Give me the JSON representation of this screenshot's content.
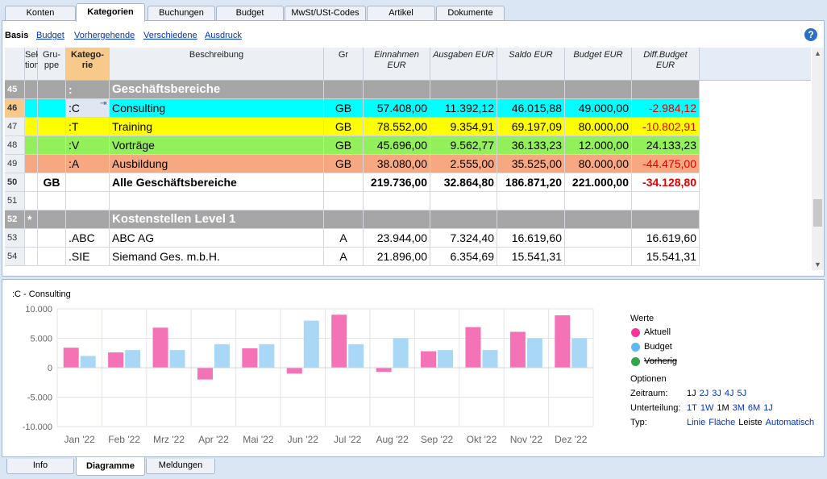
{
  "tabs": [
    "Konten",
    "Kategorien",
    "Buchungen",
    "Budget",
    "MwSt/USt-Codes",
    "Artikel",
    "Dokumente"
  ],
  "active_tab": "Kategorien",
  "views": {
    "active": "Basis",
    "links": [
      "Budget",
      "Vorhergehende",
      "Verschiedene",
      "Ausdruck"
    ]
  },
  "help_label": "?",
  "headers": {
    "sektion": "Sek tion",
    "gruppe": "Gru-ppe",
    "kategorie": "Katego-rie",
    "beschreibung": "Beschreibung",
    "gr": "Gr",
    "einnahmen": "Einnahmen EUR",
    "ausgaben": "Ausgaben EUR",
    "saldo": "Saldo EUR",
    "budget": "Budget EUR",
    "diff": "Diff.Budget EUR"
  },
  "rows": [
    {
      "nr": "45",
      "sektion": "",
      "gruppe": "",
      "kategorie": ":",
      "beschreibung": "Geschäftsbereiche",
      "gr": "",
      "einnahmen": "",
      "ausgaben": "",
      "saldo": "",
      "budget": "",
      "diff": "",
      "style": "gray"
    },
    {
      "nr": "46",
      "sektion": "",
      "gruppe": "",
      "kategorie": ":C",
      "beschreibung": "Consulting",
      "gr": "GB",
      "einnahmen": "57.408,00",
      "ausgaben": "11.392,12",
      "saldo": "46.015,88",
      "budget": "49.000,00",
      "diff": "-2.984,12",
      "style": "cyan"
    },
    {
      "nr": "47",
      "sektion": "",
      "gruppe": "",
      "kategorie": ":T",
      "beschreibung": "Training",
      "gr": "GB",
      "einnahmen": "78.552,00",
      "ausgaben": "9.354,91",
      "saldo": "69.197,09",
      "budget": "80.000,00",
      "diff": "-10.802,91",
      "style": "yellow"
    },
    {
      "nr": "48",
      "sektion": "",
      "gruppe": "",
      "kategorie": ":V",
      "beschreibung": "Vorträge",
      "gr": "GB",
      "einnahmen": "45.696,00",
      "ausgaben": "9.562,77",
      "saldo": "36.133,23",
      "budget": "12.000,00",
      "diff": "24.133,23",
      "style": "green"
    },
    {
      "nr": "49",
      "sektion": "",
      "gruppe": "",
      "kategorie": ":A",
      "beschreibung": "Ausbildung",
      "gr": "GB",
      "einnahmen": "38.080,00",
      "ausgaben": "2.555,00",
      "saldo": "35.525,00",
      "budget": "80.000,00",
      "diff": "-44.475,00",
      "style": "orange"
    },
    {
      "nr": "50",
      "sektion": "",
      "gruppe": "GB",
      "kategorie": "",
      "beschreibung": "Alle Geschäftsbereiche",
      "gr": "",
      "einnahmen": "219.736,00",
      "ausgaben": "32.864,80",
      "saldo": "186.871,20",
      "budget": "221.000,00",
      "diff": "-34.128,80",
      "style": "total"
    },
    {
      "nr": "51",
      "sektion": "",
      "gruppe": "",
      "kategorie": "",
      "beschreibung": "",
      "gr": "",
      "einnahmen": "",
      "ausgaben": "",
      "saldo": "",
      "budget": "",
      "diff": "",
      "style": "plain"
    },
    {
      "nr": "52",
      "sektion": "*",
      "gruppe": "",
      "kategorie": "",
      "beschreibung": "Kostenstellen Level 1",
      "gr": "",
      "einnahmen": "",
      "ausgaben": "",
      "saldo": "",
      "budget": "",
      "diff": "",
      "style": "gray"
    },
    {
      "nr": "53",
      "sektion": "",
      "gruppe": "",
      "kategorie": ".ABC",
      "beschreibung": "ABC AG",
      "gr": "A",
      "einnahmen": "23.944,00",
      "ausgaben": "7.324,40",
      "saldo": "16.619,60",
      "budget": "",
      "diff": "16.619,60",
      "style": "plain"
    },
    {
      "nr": "54",
      "sektion": "",
      "gruppe": "",
      "kategorie": ".SIE",
      "beschreibung": "Siemand Ges. m.b.H.",
      "gr": "A",
      "einnahmen": "21.896,00",
      "ausgaben": "6.354,69",
      "saldo": "15.541,31",
      "budget": "",
      "diff": "15.541,31",
      "style": "plain"
    }
  ],
  "selected_row": "46",
  "row_colors": {
    "cyan": "#00ffff",
    "yellow": "#ffff00",
    "green": "#92f05a",
    "orange": "#f8a880",
    "gray": "#a6a6a6",
    "red_text": "#e00000"
  },
  "chart_title": ":C - Consulting",
  "chart_data": {
    "type": "bar",
    "categories": [
      "Jan '22",
      "Feb '22",
      "Mrz '22",
      "Apr '22",
      "Mai '22",
      "Jun '22",
      "Jul '22",
      "Aug '22",
      "Sep '22",
      "Okt '22",
      "Nov '22",
      "Dez '22"
    ],
    "series": [
      {
        "name": "Aktuell",
        "color": "#f472b6",
        "values": [
          3400,
          2600,
          6800,
          -2000,
          3300,
          -1000,
          9000,
          -700,
          2800,
          6900,
          6100,
          8900
        ]
      },
      {
        "name": "Budget",
        "color": "#a9d8f6",
        "values": [
          2000,
          3000,
          3000,
          4000,
          4000,
          8000,
          4000,
          5000,
          3000,
          3000,
          5000,
          5000
        ]
      }
    ],
    "ylim": [
      -10000,
      10000
    ],
    "yticks": [
      "10.000",
      "5.000",
      "0",
      "-5.000",
      "-10.000"
    ],
    "grid": true
  },
  "legend": {
    "title": "Werte",
    "items": [
      {
        "label": "Aktuell",
        "color": "#ff3399",
        "strike": false
      },
      {
        "label": "Budget",
        "color": "#5bb8f5",
        "strike": false
      },
      {
        "label": "Vorherig",
        "color": "#2ea84a",
        "strike": true
      }
    ]
  },
  "options": {
    "title": "Optionen",
    "zeitraum_label": "Zeitraum:",
    "zeitraum": [
      {
        "t": "1J",
        "link": false
      },
      {
        "t": "2J",
        "link": true
      },
      {
        "t": "3J",
        "link": true
      },
      {
        "t": "4J",
        "link": true
      },
      {
        "t": "5J",
        "link": true
      }
    ],
    "unterteilung_label": "Unterteilung:",
    "unterteilung": [
      {
        "t": "1T",
        "link": true
      },
      {
        "t": "1W",
        "link": true
      },
      {
        "t": "1M",
        "link": false
      },
      {
        "t": "3M",
        "link": true
      },
      {
        "t": "6M",
        "link": true
      },
      {
        "t": "1J",
        "link": true
      }
    ],
    "typ_label": "Typ:",
    "typ": [
      {
        "t": "Linie",
        "link": true
      },
      {
        "t": "Fläche",
        "link": true
      },
      {
        "t": "Leiste",
        "link": false
      },
      {
        "t": "Automatisch",
        "link": true
      }
    ]
  },
  "bottom_tabs": [
    "Info",
    "Diagramme",
    "Meldungen"
  ],
  "active_bottom_tab": "Diagramme"
}
